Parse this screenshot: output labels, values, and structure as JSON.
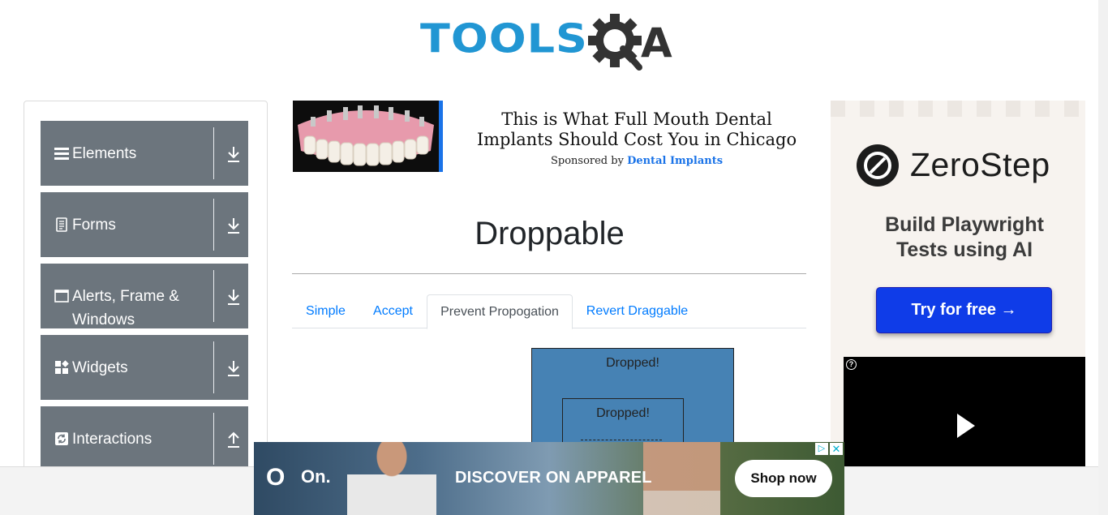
{
  "header": {
    "logo_text": "TOOLS",
    "logo_suffix": "A"
  },
  "sidebar": {
    "groups": [
      {
        "label": "Elements",
        "icon": "menu-icon",
        "expanded": false
      },
      {
        "label": "Forms",
        "icon": "document-icon",
        "expanded": false
      },
      {
        "label": "Alerts, Frame & Windows",
        "icon": "window-icon",
        "expanded": false
      },
      {
        "label": "Widgets",
        "icon": "widgets-icon",
        "expanded": false
      },
      {
        "label": "Interactions",
        "icon": "interactions-icon",
        "expanded": true
      }
    ]
  },
  "sponsored_ad": {
    "title": "This is What Full Mouth Dental Implants Should Cost You in Chicago",
    "sponsor_prefix": "Sponsored by",
    "sponsor_name": "Dental Implants"
  },
  "main": {
    "title": "Droppable",
    "tabs": [
      {
        "label": "Simple",
        "active": false
      },
      {
        "label": "Accept",
        "active": false
      },
      {
        "label": "Prevent Propogation",
        "active": true
      },
      {
        "label": "Revert Draggable",
        "active": false
      }
    ],
    "outer_drop_text": "Dropped!",
    "inner_drop_text": "Dropped!"
  },
  "right_ad": {
    "brand": "ZeroStep",
    "tagline": "Build Playwright Tests using AI",
    "cta": "Try for free →"
  },
  "bottom_ad": {
    "brand_glyph": "O",
    "brand": "On.",
    "headline": "DISCOVER ON APPAREL",
    "cta": "Shop now"
  },
  "colors": {
    "accent": "#007bff",
    "sidebar_group_bg": "#6c757d",
    "drop_box_bg": "#4682b4",
    "logo_blue": "#2196d3",
    "zerostep_cta": "#0f3ce8"
  }
}
